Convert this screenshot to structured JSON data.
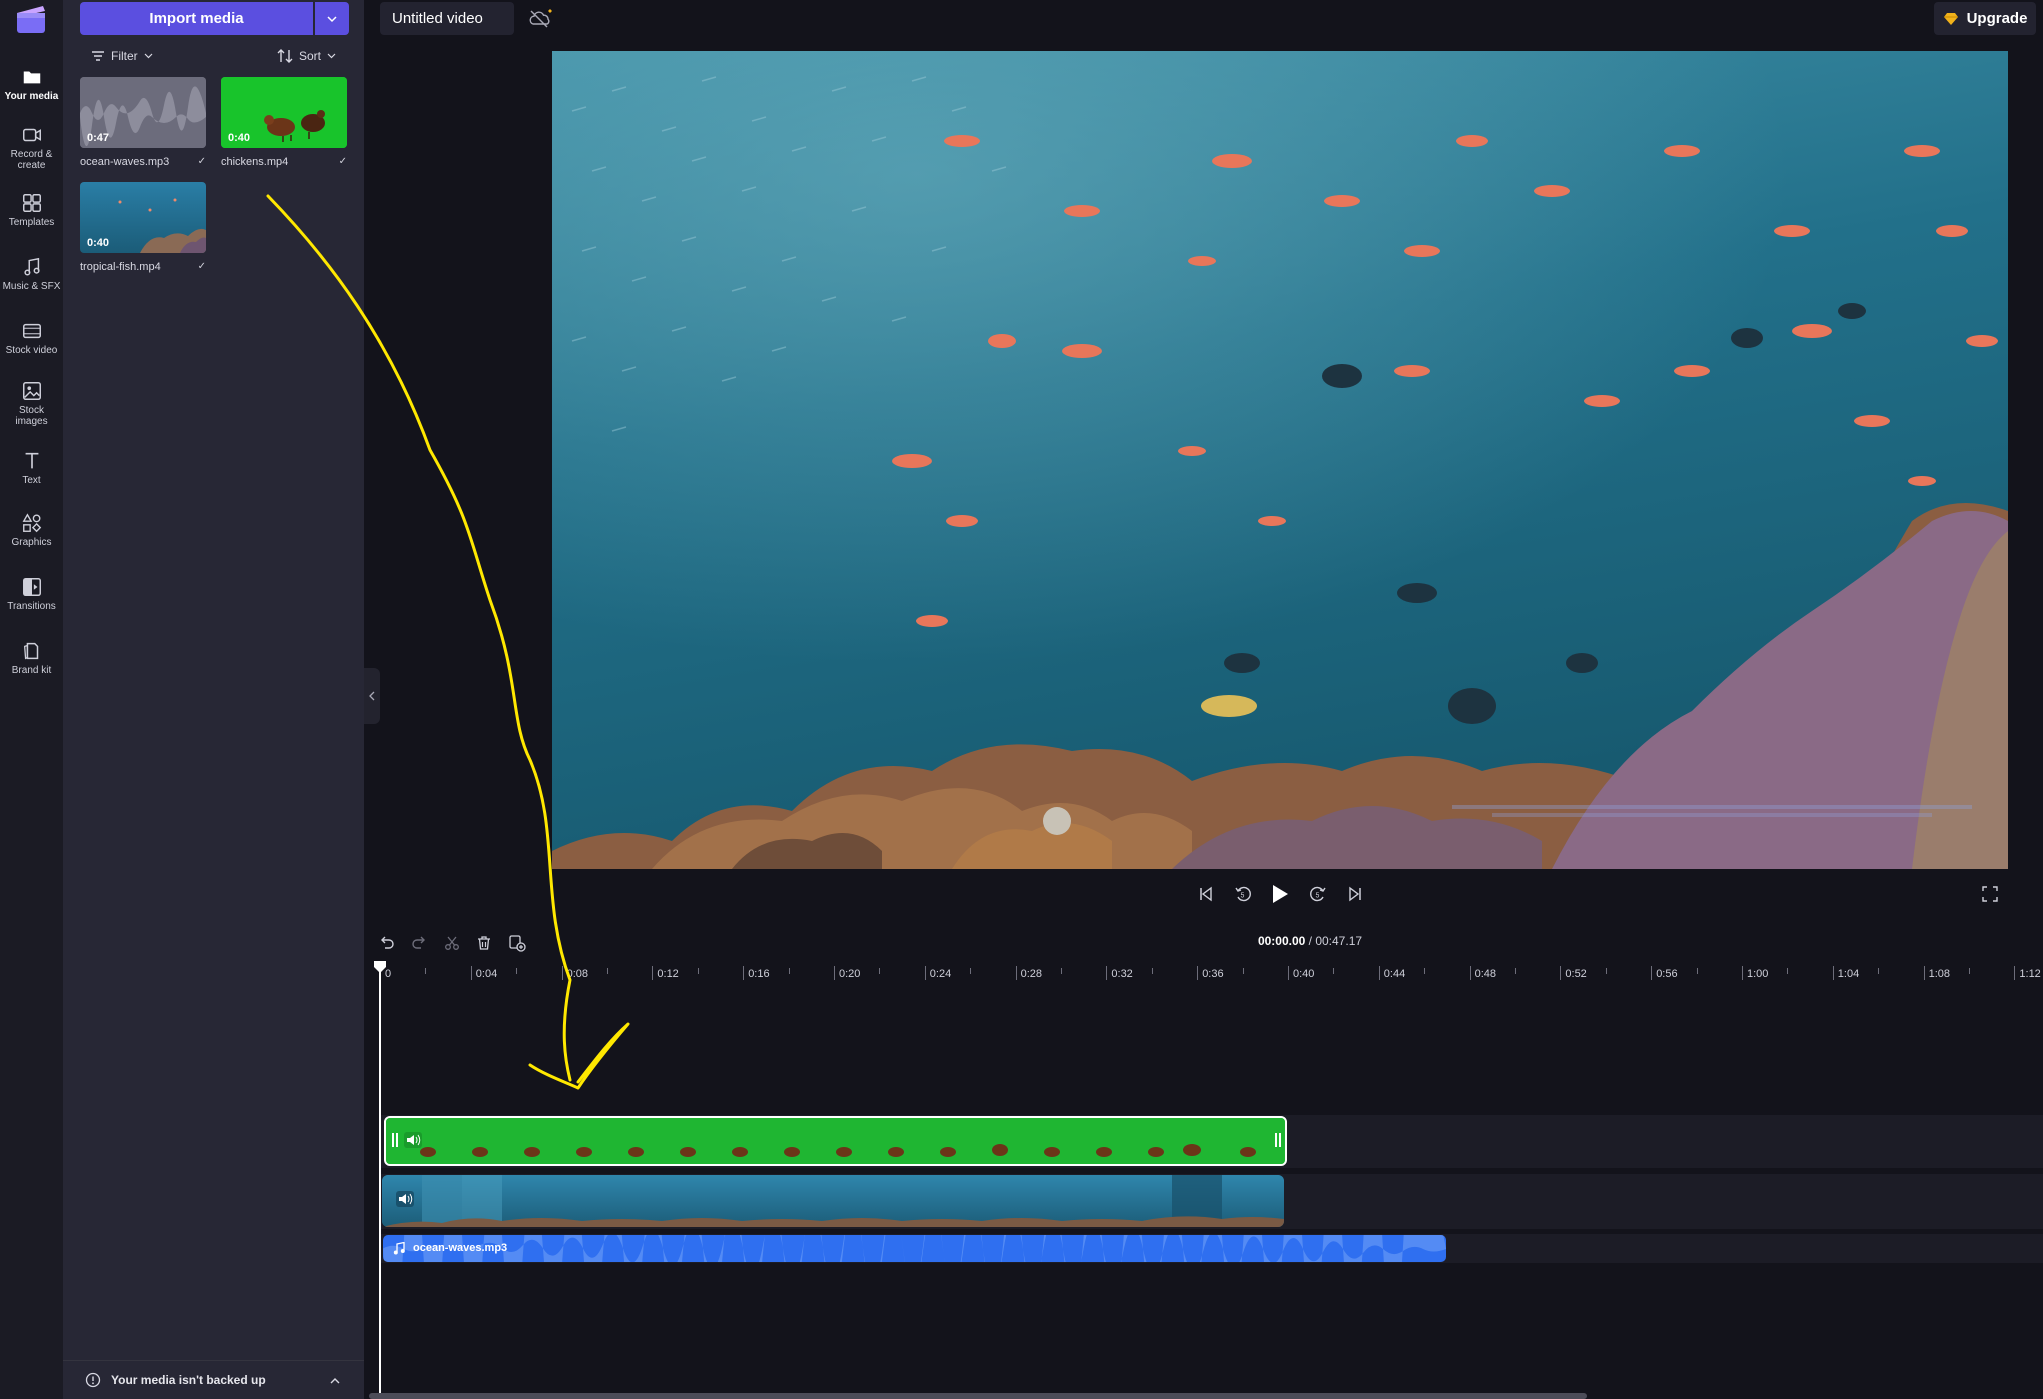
{
  "sidebar": {
    "items": [
      {
        "label": "Your media",
        "icon": "folder-icon",
        "active": true
      },
      {
        "label": "Record & create",
        "icon": "camera-icon"
      },
      {
        "label": "Templates",
        "icon": "templates-icon"
      },
      {
        "label": "Music & SFX",
        "icon": "music-note-icon"
      },
      {
        "label": "Stock video",
        "icon": "film-icon"
      },
      {
        "label": "Stock images",
        "icon": "image-icon"
      },
      {
        "label": "Text",
        "icon": "text-icon"
      },
      {
        "label": "Graphics",
        "icon": "shapes-icon"
      },
      {
        "label": "Transitions",
        "icon": "transitions-icon"
      },
      {
        "label": "Brand kit",
        "icon": "brand-kit-icon"
      }
    ]
  },
  "media_panel": {
    "import_label": "Import media",
    "filter_label": "Filter",
    "sort_label": "Sort",
    "items": [
      {
        "name": "ocean-waves.mp3",
        "duration": "0:47",
        "type": "audio"
      },
      {
        "name": "chickens.mp4",
        "duration": "0:40",
        "type": "video"
      },
      {
        "name": "tropical-fish.mp4",
        "duration": "0:40",
        "type": "video"
      }
    ],
    "backup_notice": "Your media isn't backed up"
  },
  "header": {
    "project_title": "Untitled video",
    "upgrade_label": "Upgrade"
  },
  "timeline": {
    "current_time": "00:00.00",
    "separator": " / ",
    "total_time": "00:47.17",
    "ruler_labels": [
      "0",
      "0:04",
      "0:08",
      "0:12",
      "0:16",
      "0:20",
      "0:24",
      "0:28",
      "0:32",
      "0:36",
      "0:40",
      "0:44",
      "0:48",
      "0:52",
      "0:56",
      "1:00",
      "1:04",
      "1:08",
      "1:12"
    ],
    "tracks": [
      {
        "clip": "chickens.mp4",
        "kind": "video",
        "color": "#1fb632"
      },
      {
        "clip": "tropical-fish.mp4",
        "kind": "video",
        "color": "#1d5f80"
      },
      {
        "clip": "ocean-waves.mp3",
        "kind": "audio",
        "color": "#2f6ff0"
      }
    ]
  },
  "colors": {
    "accent": "#5b4fe0",
    "annotation": "#ffe800"
  }
}
